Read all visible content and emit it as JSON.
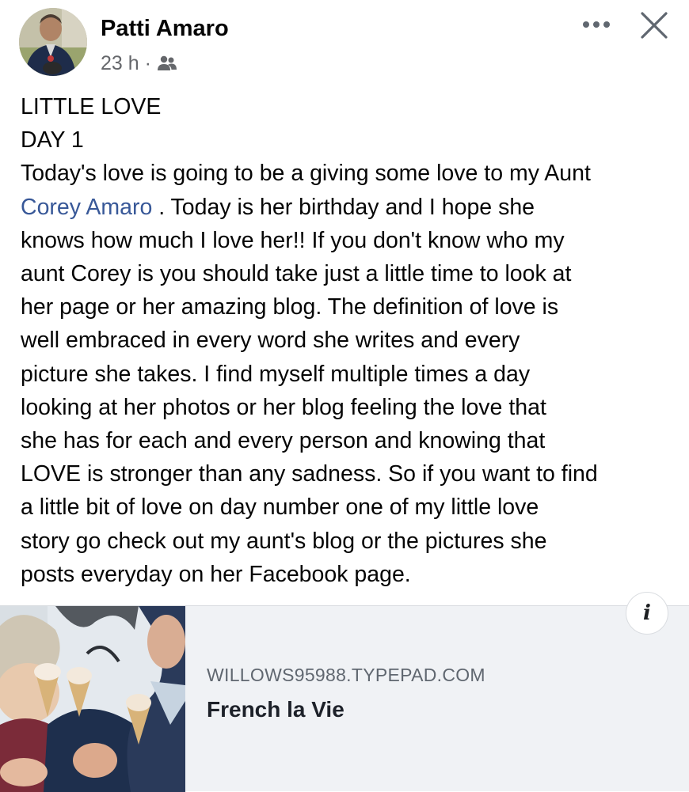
{
  "post": {
    "author": "Patti Amaro",
    "time": "23 h",
    "separator": "·",
    "audience_icon": "friends-icon",
    "text_lines": [
      "LITTLE LOVE",
      "DAY 1",
      "Today's love is going to be a giving some love to my Aunt",
      "",
      "knows how much I love her!! If you don't know who my",
      "aunt Corey is you should take just a little time to look at",
      "her page or her amazing blog. The definition of love is",
      "well embraced in every word she writes and every",
      "picture she takes. I find myself multiple times a day",
      "looking at her photos or her blog feeling the love that",
      "she has for each and every person and knowing that",
      "LOVE is stronger than any sadness. So if you want to find",
      "a little bit of love on day number one of my little love",
      "story go check out my aunt's blog or the pictures she",
      "posts everyday on her Facebook page."
    ],
    "mention": "Corey Amaro",
    "mention_tail": " . Today is her birthday and I hope she"
  },
  "link_preview": {
    "domain": "WILLOWS95988.TYPEPAD.COM",
    "title": "French la Vie",
    "info_label": "i"
  },
  "colors": {
    "link_blue": "#385898",
    "secondary_text": "#65676b",
    "card_bg": "#f0f2f5"
  }
}
